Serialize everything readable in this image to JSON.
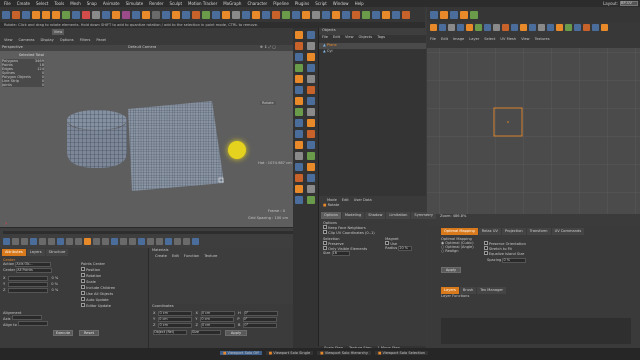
{
  "app": {
    "menu": [
      "File",
      "Create",
      "Select",
      "Tools",
      "Mesh",
      "Snap",
      "Animate",
      "Simulate",
      "Render",
      "Sculpt",
      "Motion Tracker",
      "MoGraph",
      "Character",
      "Pipeline",
      "Plugins",
      "Script",
      "Window",
      "Help"
    ],
    "layout_label": "Layout:",
    "layout_value": "BP-UV"
  },
  "status_top": "Rotate: Click and drag to rotate elements. Hold down SHIFT to add to quantize rotation / add to the selection in point mode, CTRL to remove.",
  "viewport": {
    "tab": "View",
    "title": "Perspective",
    "menu": [
      "View",
      "Cameras",
      "Display",
      "Options",
      "Filters",
      "Panel"
    ],
    "camera": "Default Camera",
    "stats_title": "Selected Total",
    "stats": [
      {
        "label": "Polygons",
        "value": "3469"
      },
      {
        "label": "Points",
        "value": "18"
      },
      {
        "label": "Edges",
        "value": "124"
      },
      {
        "label": "Splines",
        "value": "0"
      },
      {
        "label": "Polygon Objects",
        "value": "0"
      },
      {
        "label": "Line Strip",
        "value": "0"
      },
      {
        "label": "Joints",
        "value": "0"
      }
    ],
    "rotate_label": "Rotate",
    "fps": "Frame : 0",
    "grid": "Grid Spacing : 100 cm",
    "coord_readout": "Hot : 1074.987 cm"
  },
  "objects_panel": {
    "title": "Objects",
    "menu": [
      "File",
      "Edit",
      "View",
      "Objects",
      "Tags"
    ],
    "items": [
      "Plane",
      "Cyl"
    ]
  },
  "attributes": {
    "tabs": [
      "Mode",
      "Edit",
      "User Data"
    ],
    "header": "Rotate",
    "tool_tabs": [
      "Options",
      "Modeling",
      "Shadow",
      "Limitation",
      "Symmetry"
    ],
    "options_title": "Options",
    "opt_keep": "Keep Face Neighbors",
    "opt_clip": "Clip UV Coordinates (0..1)",
    "selection_title": "Selection",
    "magnet_title": "Magnet",
    "sel_options": [
      "Preserve",
      "Only Visible Elements"
    ],
    "magnet_options": [
      "Use",
      "Radius"
    ],
    "radius_value": "20 %",
    "size_label": "Size",
    "size_value": "16"
  },
  "uv_editor": {
    "menu": [
      "File",
      "Edit",
      "Image",
      "Layer",
      "Select",
      "UV Mesh",
      "View",
      "Textures"
    ],
    "zoom_readout": "Zoom: 486.8%",
    "lower_tabs": [
      "Optimal Mapping",
      "Relax UV",
      "Projection",
      "Transform",
      "UV Commands"
    ],
    "mapping_title": "Optimal Mapping",
    "map_opts_left": [
      "Optimal (Cubic)",
      "Optimal (Angle)",
      "Realign"
    ],
    "map_opts_right": [
      "Preserve Orientation",
      "Stretch to Fit",
      "Equalize Island Size"
    ],
    "spacing_label": "Spacing",
    "spacing_value": "0 %",
    "apply": "Apply",
    "layers_tabs": [
      "Layers",
      "Brush",
      "Tex Manager"
    ],
    "layers_menu": "Layer   Functions"
  },
  "bottom_left": {
    "tabs": [
      "Attributes",
      "Layers",
      "Structure"
    ],
    "section": "Center",
    "action_label": "Action",
    "action_value": "Axis Ob...",
    "center_label": "Center",
    "center_value": "All Points",
    "rows": [
      "X",
      "Y",
      "Z"
    ],
    "row_values": [
      "0 %",
      "0 %",
      "0 %"
    ],
    "points_center": "Points Center",
    "checkbox_items": [
      "Position",
      "Rotation",
      "Scale",
      "Include Children",
      "Use All Objects",
      "Auto Update",
      "Editor Update"
    ],
    "alignment": "Alignment",
    "align_axis": "Axis",
    "align_to": "Align to",
    "buttons": [
      "Execute",
      "Reset"
    ]
  },
  "materials": {
    "title": "Materials",
    "menu": [
      "Create",
      "Edit",
      "Function",
      "Texture"
    ]
  },
  "coordinates": {
    "title": "Coordinates",
    "rows": [
      {
        "a": "X",
        "av": "0 cm",
        "b": "X",
        "bv": "0 cm",
        "c": "H",
        "cv": "0°"
      },
      {
        "a": "Y",
        "av": "0 cm",
        "b": "Y",
        "bv": "0 cm",
        "c": "P",
        "cv": "0°"
      },
      {
        "a": "Z",
        "av": "0 cm",
        "b": "Z",
        "bv": "0 cm",
        "c": "B",
        "cv": "0°"
      }
    ],
    "mode_value": "Object (Rel)",
    "size_value": "Size",
    "apply": "Apply"
  },
  "timeline": {
    "left": "Scale Step",
    "mid": "Texture Step",
    "right": "1 Move Step"
  },
  "taskbar": {
    "items": [
      "Viewport Solo Off",
      "Viewport Solo Single",
      "Viewport Solo Hierarchy",
      "Viewport Solo Selection"
    ]
  },
  "colors": {
    "accent": "#e8892a",
    "toolbar_blue": "#4b6d9b",
    "uv_highlight": "#e8892a",
    "light_yellow": "#e4d21e"
  }
}
